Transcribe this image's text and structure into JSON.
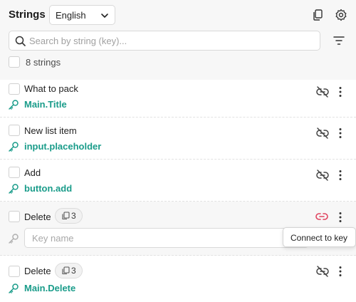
{
  "header": {
    "title": "Strings",
    "language": "English",
    "icons": [
      "copy-icon",
      "gear-icon",
      "filter-icon",
      "search-icon",
      "chevron-down-icon"
    ]
  },
  "search": {
    "placeholder": "Search by string (key)..."
  },
  "summary": {
    "count_label": "8 strings"
  },
  "rows": [
    {
      "label": "What to pack",
      "key": "Main.Title",
      "linked": true
    },
    {
      "label": "New list item",
      "key": "input.placeholder",
      "linked": true
    },
    {
      "label": "Add",
      "key": "button.add",
      "linked": true
    },
    {
      "label": "Delete",
      "copies": "3",
      "key_placeholder": "Key name",
      "linked": false
    },
    {
      "label": "Delete",
      "copies": "3",
      "key": "Main.Delete",
      "linked": true
    }
  ],
  "tooltip": {
    "text": "Connect to key"
  },
  "colors": {
    "key_text": "#1a9c8a",
    "unlinked_accent": "#e0435f",
    "header_bg": "#f7f7f7"
  }
}
